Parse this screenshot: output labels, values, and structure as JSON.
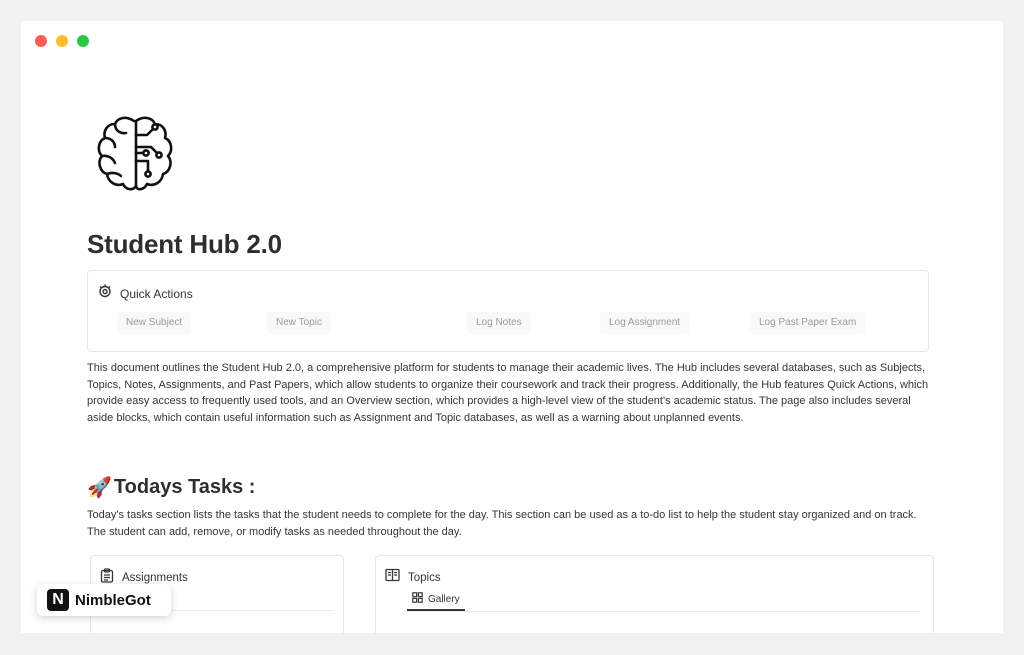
{
  "window": {
    "controls": [
      "close",
      "minimize",
      "maximize"
    ]
  },
  "page": {
    "icon": "brain-circuit-icon",
    "title": "Student Hub 2.0"
  },
  "quick_actions": {
    "label": "Quick Actions",
    "icon": "gear-icon",
    "buttons": [
      "New Subject",
      "New Topic",
      "Log Notes",
      "Log Assignment",
      "Log Past Paper Exam"
    ]
  },
  "intro_paragraph": "This document outlines the Student Hub 2.0, a comprehensive platform for students to manage their academic lives. The Hub includes several databases, such as Subjects, Topics, Notes, Assignments, and Past Papers, which allow students to organize their coursework and track their progress. Additionally, the Hub features Quick Actions, which provide easy access to frequently used tools, and an Overview section, which provides a high-level view of the student's academic status. The page also includes several aside blocks, which contain useful information such as Assignment and Topic databases, as well as a warning about unplanned events.",
  "todays_tasks": {
    "emoji": "🚀",
    "heading": "Todays Tasks :",
    "description": "Today's tasks section lists the tasks that the student needs to complete for the day. This section can be used as a to-do list to help the student stay organized and on track. The student can add, remove, or modify tasks as needed throughout the day."
  },
  "assignments_card": {
    "label": "Assignments",
    "icon": "clipboard-icon"
  },
  "topics_card": {
    "label": "Topics",
    "icon": "book-icon",
    "tab": "Gallery",
    "tab_icon": "grid-icon"
  },
  "badge": {
    "logo_letter": "N",
    "brand": "NimbleGot"
  },
  "colors": {
    "title": "#2f2e2a",
    "text": "#37352f",
    "muted": "#9b9a97",
    "border": "#e6e6e4",
    "background": "#f1f1f1"
  }
}
